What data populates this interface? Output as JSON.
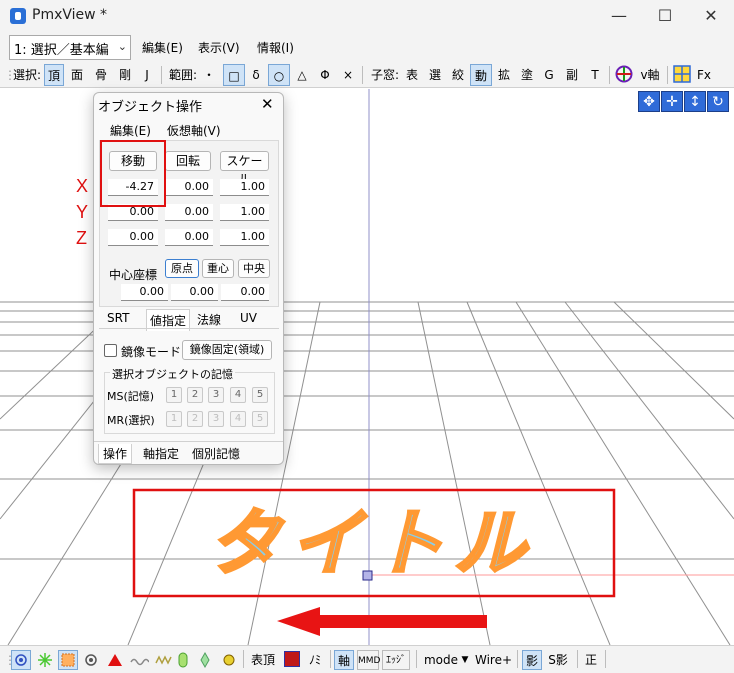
{
  "window": {
    "title": "PmxView *",
    "minimize": "—",
    "maximize": "☐",
    "close": "✕"
  },
  "menubar": {
    "mode_select": "1: 選択／基本編",
    "menus": [
      "編集(E)",
      "表示(V)",
      "情報(I)"
    ]
  },
  "toolbar": {
    "select_label": "選択:",
    "select_items": [
      "頂",
      "面",
      "骨",
      "剛",
      "J"
    ],
    "range_label": "範囲:",
    "range_items": [
      "・",
      "□",
      "δ",
      "○",
      "△",
      "Φ",
      "×"
    ],
    "child_label": "子窓:",
    "child_items": [
      "表",
      "選",
      "絞",
      "動",
      "拡",
      "塗",
      "G",
      "副",
      "T"
    ],
    "v_axis": "v軸",
    "fx": "Fx"
  },
  "dialog": {
    "title": "オブジェクト操作",
    "menus": [
      "編集(E)",
      "仮想軸(V)"
    ],
    "buttons": {
      "move": "移動",
      "rotate": "回転",
      "scale": "スケール"
    },
    "rows": [
      [
        "-4.27",
        "0.00",
        "1.00"
      ],
      [
        "0.00",
        "0.00",
        "1.00"
      ],
      [
        "0.00",
        "0.00",
        "1.00"
      ]
    ],
    "center_label": "中心座標",
    "center_buttons": [
      "原点",
      "重心",
      "中央"
    ],
    "center_values": [
      "0.00",
      "0.00",
      "0.00"
    ],
    "subtabs": [
      "SRT",
      "値指定",
      "法線",
      "UV"
    ],
    "mirror_mode": "鏡像モード",
    "mirror_fixed": "鏡像固定(領域)",
    "memory_title": "選択オブジェクトの記憶",
    "ms_label": "MS(記憶)",
    "mr_label": "MR(選択)",
    "slots": [
      "1",
      "2",
      "3",
      "4",
      "5"
    ],
    "bottom_tabs": [
      "操作",
      "軸指定",
      "個別記憶"
    ]
  },
  "annotations": {
    "x": "X",
    "y": "Y",
    "z": "Z"
  },
  "scene": {
    "title_text": "タイトル"
  },
  "statusbar": {
    "table_vertex": "表頂",
    "no_label": "ﾉﾐ",
    "axis": "軸",
    "mmd": "MMD",
    "edge": "ｴｯｼﾞ",
    "mode": "mode",
    "wire": "Wire+",
    "shadow": "影",
    "sshadow": "S影",
    "ortho": "正"
  },
  "colors": {
    "highlight_red": "#e01010",
    "text_fill": "#87ceeb",
    "text_outline": "#ff9933",
    "accent_blue": "#2f6bd8"
  }
}
